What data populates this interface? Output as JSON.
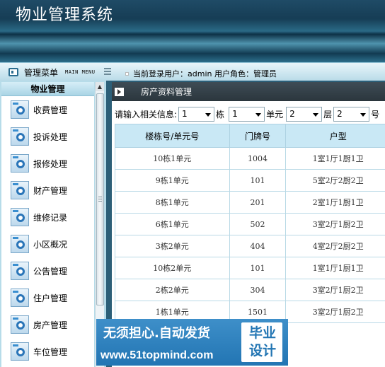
{
  "app": {
    "title": "物业管理系统"
  },
  "topbar": {
    "menu_title": "管理菜单",
    "menu_subtitle": "MAIN MENU",
    "user_info": "当前登录用户：admin 用户角色：管理员"
  },
  "sidebar": {
    "group_title": "物业管理",
    "items": [
      {
        "label": "收费管理",
        "icon": "gear-icon"
      },
      {
        "label": "投诉处理",
        "icon": "gear-icon"
      },
      {
        "label": "报修处理",
        "icon": "gear-icon"
      },
      {
        "label": "财产管理",
        "icon": "gear-icon"
      },
      {
        "label": "维修记录",
        "icon": "gear-icon"
      },
      {
        "label": "小区概况",
        "icon": "gear-icon"
      },
      {
        "label": "公告管理",
        "icon": "gear-icon"
      },
      {
        "label": "住户管理",
        "icon": "gear-icon"
      },
      {
        "label": "房产管理",
        "icon": "gear-icon"
      },
      {
        "label": "车位管理",
        "icon": "gear-icon"
      }
    ]
  },
  "panel": {
    "title": "房产资料管理"
  },
  "filter": {
    "prompt": "请输入相关信息:",
    "building_value": "1",
    "building_unit": "栋",
    "unit_value": "1",
    "unit_unit": "单元",
    "floor_value": "2",
    "floor_unit": "层",
    "room_value": "2",
    "room_unit": "号"
  },
  "table": {
    "headers": [
      "楼栋号/单元号",
      "门牌号",
      "户型"
    ],
    "rows": [
      [
        "10栋1单元",
        "1004",
        "1室1厅1厨1卫"
      ],
      [
        "9栋1单元",
        "101",
        "5室2厅2厨2卫"
      ],
      [
        "8栋1单元",
        "201",
        "2室1厅1厨1卫"
      ],
      [
        "6栋1单元",
        "502",
        "3室2厅1厨2卫"
      ],
      [
        "3栋2单元",
        "404",
        "4室2厅2厨2卫"
      ],
      [
        "10栋2单元",
        "101",
        "1室1厅1厨1卫"
      ],
      [
        "2栋2单元",
        "304",
        "3室2厅1厨2卫"
      ],
      [
        "1栋1单元",
        "1501",
        "3室2厅1厨2卫"
      ]
    ]
  },
  "watermark": {
    "slogan": "无须担心.自动发货",
    "url": "www.51topmind.com",
    "badge": "毕业设计"
  }
}
